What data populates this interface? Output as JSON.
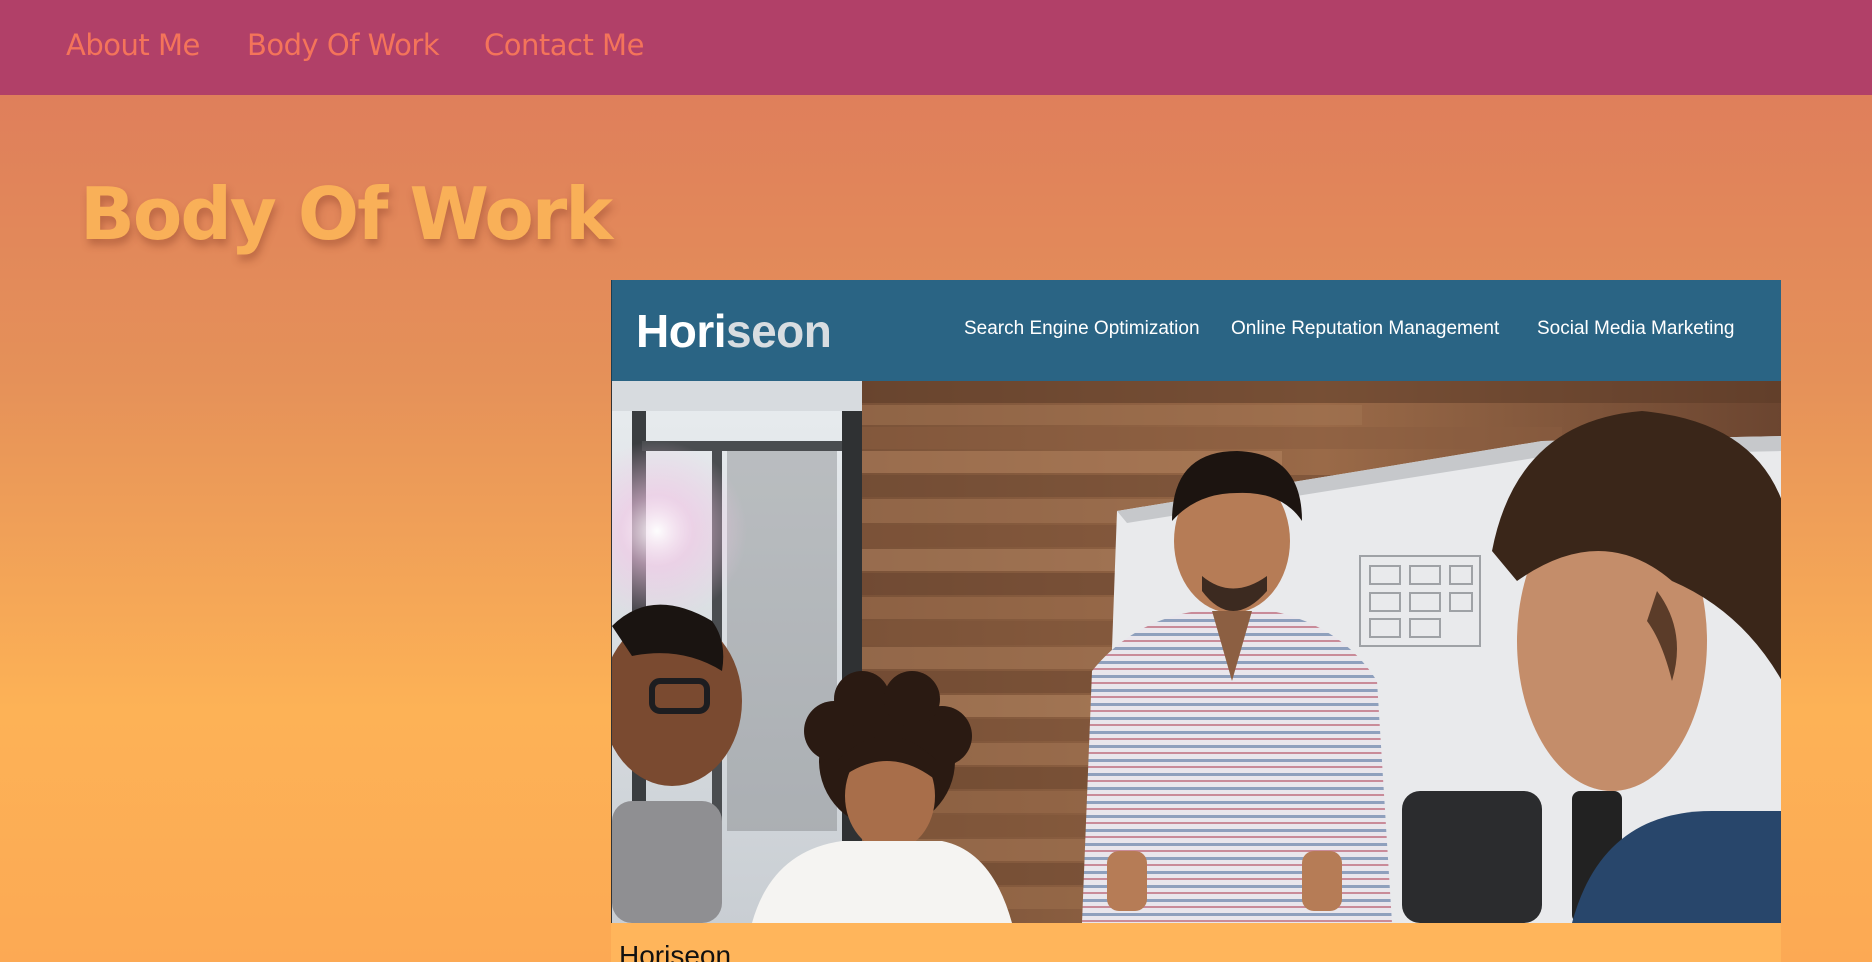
{
  "nav": {
    "items": [
      {
        "label": "About Me"
      },
      {
        "label": "Body Of Work"
      },
      {
        "label": "Contact Me"
      }
    ]
  },
  "section": {
    "title": "Body Of Work"
  },
  "project": {
    "logo_part1": "Hori",
    "logo_part2": "seon",
    "nav": [
      "Search Engine Optimization",
      "Online Reputation Management",
      "Social Media Marketing"
    ],
    "caption": "Horiseon"
  },
  "colors": {
    "nav_bg": "#b14068",
    "nav_link": "#f4745a",
    "title": "#f9b058",
    "project_header": "#2a6484"
  }
}
